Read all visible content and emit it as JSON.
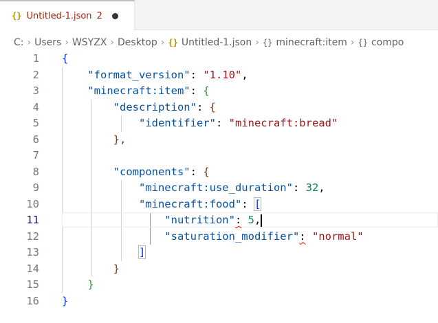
{
  "tab": {
    "icon": "{}",
    "title": "Untitled-1.json",
    "problem_count": "2"
  },
  "breadcrumb": {
    "drive": "C:",
    "users": "Users",
    "user": "WSYZX",
    "desktop": "Desktop",
    "file": "Untitled-1.json",
    "object_icon": "{}",
    "item": "minecraft:item",
    "component_partial": "compo"
  },
  "editor": {
    "line_numbers": [
      "1",
      "2",
      "3",
      "4",
      "5",
      "6",
      "7",
      "8",
      "9",
      "10",
      "11",
      "12",
      "13",
      "14",
      "15",
      "16"
    ],
    "active_line": "11",
    "tokens": {
      "open_brace": "{",
      "close_brace": "}",
      "open_bracket": "[",
      "close_bracket": "]",
      "close_brace_comma": "},",
      "key_format_version": "\"format_version\"",
      "val_format_version": "\"1.10\"",
      "key_minecraft_item": "\"minecraft:item\"",
      "key_description": "\"description\"",
      "key_identifier": "\"identifier\"",
      "val_identifier": "\"minecraft:bread\"",
      "key_components": "\"components\"",
      "key_use_duration": "\"minecraft:use_duration\"",
      "val_use_duration": "32",
      "key_food": "\"minecraft:food\"",
      "key_nutrition": "\"nutrition\"",
      "val_nutrition": "5",
      "key_saturation": "\"saturation_modifier\"",
      "val_saturation": "\"normal\""
    }
  }
}
